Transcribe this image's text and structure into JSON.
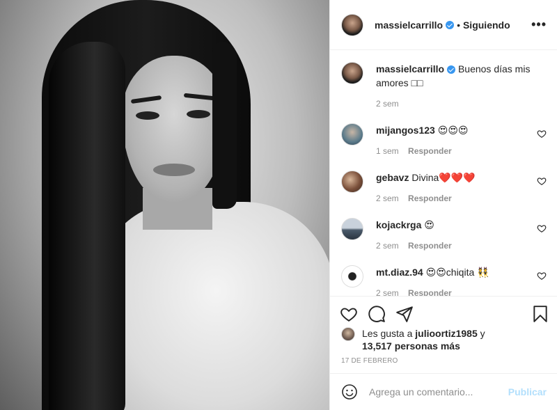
{
  "post": {
    "username": "massielcarrillo",
    "follow_dot": "•",
    "follow_label": "Siguiendo",
    "more_label": "•••"
  },
  "caption": {
    "username": "massielcarrillo",
    "text": "Buenos días mis amores □□",
    "time": "2 sem"
  },
  "comments": [
    {
      "username": "mijangos123",
      "text": "😍😍😍",
      "time": "1 sem",
      "reply": "Responder"
    },
    {
      "username": "gebavz",
      "text": "Divina❤️❤️❤️",
      "time": "2 sem",
      "reply": "Responder"
    },
    {
      "username": "kojackrga",
      "text": "😍",
      "time": "2 sem",
      "reply": "Responder"
    },
    {
      "username": "mt.diaz.94",
      "text": "😍😍chiqita 👯",
      "time": "2 sem",
      "reply": "Responder"
    }
  ],
  "likes": {
    "prefix": "Les gusta a",
    "user": "julioortiz1985",
    "and": "y",
    "count": "13,517 personas más"
  },
  "date": "17 DE FEBRERO",
  "add_comment": {
    "placeholder": "Agrega un comentario...",
    "publish_label": "Publicar"
  },
  "icons": {
    "like": "heart-icon",
    "comment": "comment-icon",
    "share": "share-icon",
    "save": "bookmark-icon",
    "emoji": "smiley-icon",
    "verified": "verified-badge-icon"
  },
  "colors": {
    "verified": "#3897f0",
    "publish_disabled": "#b2dffc",
    "meta_gray": "#8e8e8e"
  }
}
